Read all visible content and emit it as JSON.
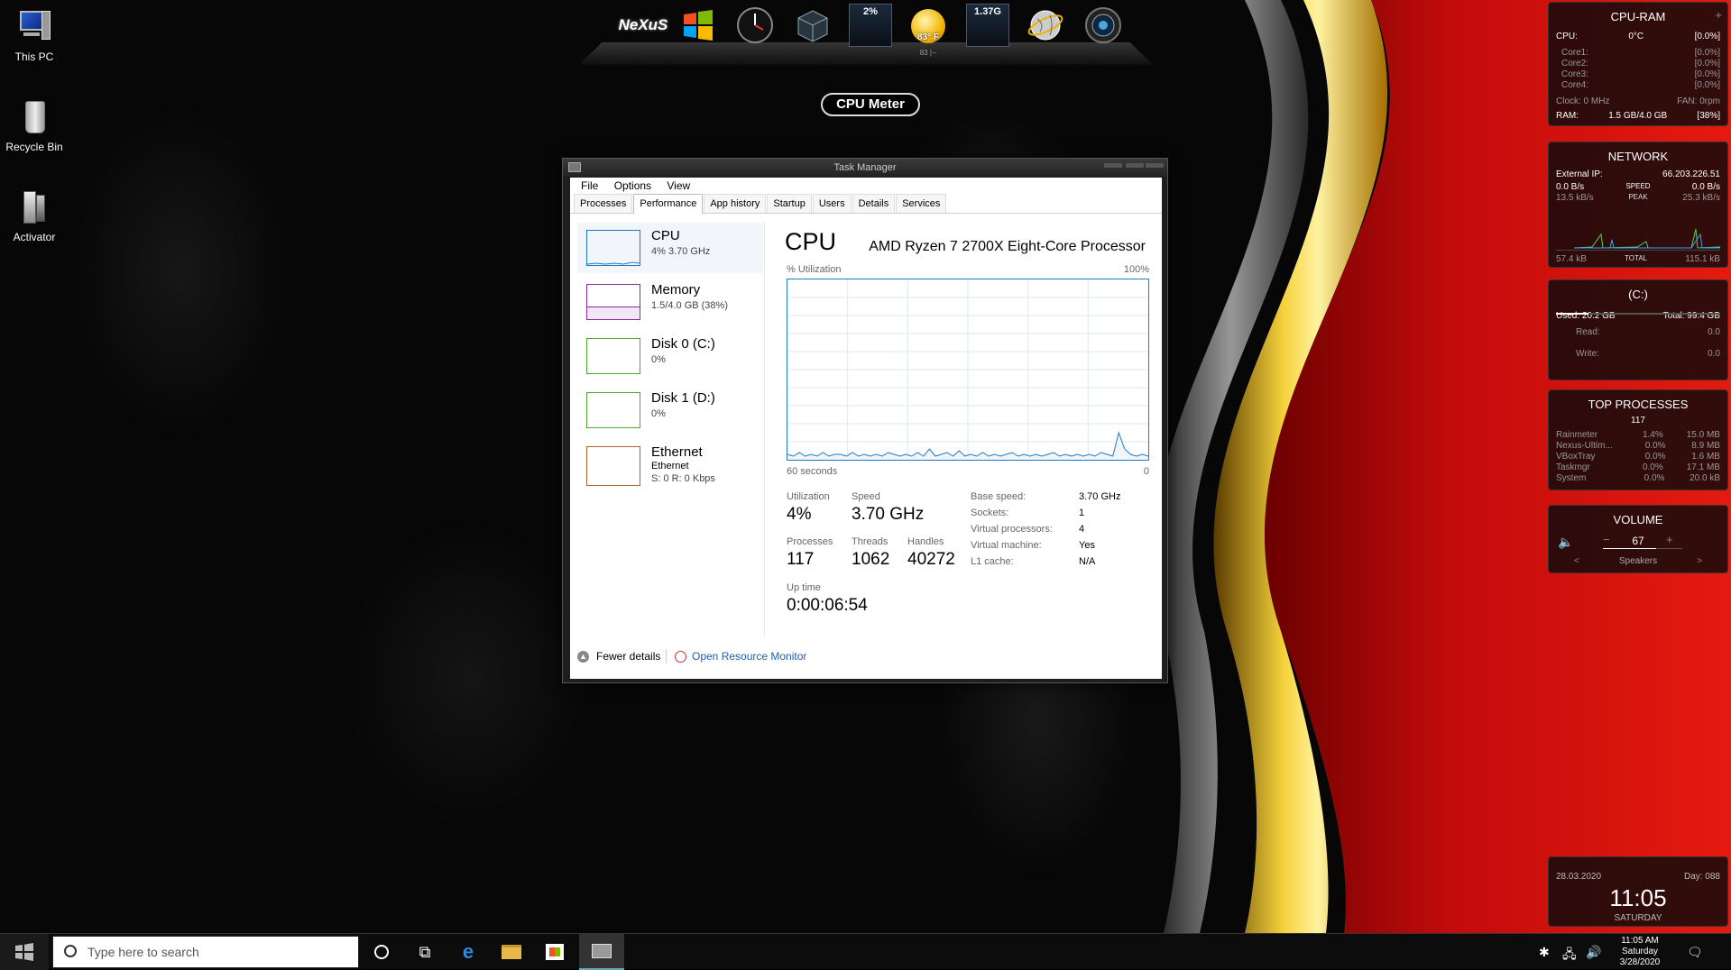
{
  "desktop": {
    "icons": [
      {
        "label": "This PC",
        "icon": "computer-icon"
      },
      {
        "label": "Recycle Bin",
        "icon": "recycle-bin-icon"
      },
      {
        "label": "Activator",
        "icon": "activator-icon"
      }
    ]
  },
  "dock": {
    "logo": "NeXuS",
    "cpu_readout": "2%",
    "weather_temp": "83° F",
    "weather_sub": "83 |--",
    "memory_readout": "1.37G",
    "meter_label": "CPU Meter"
  },
  "task_manager": {
    "title": "Task Manager",
    "menu": [
      "File",
      "Options",
      "View"
    ],
    "tabs": [
      "Processes",
      "Performance",
      "App history",
      "Startup",
      "Users",
      "Details",
      "Services"
    ],
    "active_tab": "Performance",
    "sidebar": [
      {
        "title": "CPU",
        "sub": "4% 3.70 GHz",
        "color": "#1b7ac5"
      },
      {
        "title": "Memory",
        "sub": "1.5/4.0 GB (38%)",
        "color": "#8b2ca8"
      },
      {
        "title": "Disk 0 (C:)",
        "sub": "0%",
        "color": "#4ca82c"
      },
      {
        "title": "Disk 1 (D:)",
        "sub": "0%",
        "color": "#4ca82c"
      },
      {
        "title": "Ethernet",
        "sub": "Ethernet",
        "sub2": "S: 0 R: 0 Kbps",
        "color": "#a8642c"
      }
    ],
    "main": {
      "title": "CPU",
      "model": "AMD Ryzen 7 2700X Eight-Core Processor",
      "util_label": "% Utilization",
      "max_label": "100%",
      "time_label": "60 seconds",
      "min_label": "0",
      "utilization": {
        "label": "Utilization",
        "value": "4%"
      },
      "speed": {
        "label": "Speed",
        "value": "3.70 GHz"
      },
      "processes": {
        "label": "Processes",
        "value": "117"
      },
      "threads": {
        "label": "Threads",
        "value": "1062"
      },
      "handles": {
        "label": "Handles",
        "value": "40272"
      },
      "uptime": {
        "label": "Up time",
        "value": "0:00:06:54"
      },
      "details": [
        {
          "k": "Base speed:",
          "v": "3.70 GHz"
        },
        {
          "k": "Sockets:",
          "v": "1"
        },
        {
          "k": "Virtual processors:",
          "v": "4"
        },
        {
          "k": "Virtual machine:",
          "v": "Yes"
        },
        {
          "k": "L1 cache:",
          "v": "N/A"
        }
      ],
      "graph_color": "#1b7ac5",
      "graph_values": [
        3,
        2,
        4,
        2,
        3,
        2,
        4,
        2,
        3,
        3,
        2,
        4,
        2,
        3,
        2,
        3,
        2,
        4,
        3,
        2,
        3,
        2,
        4,
        2,
        6,
        2,
        3,
        4,
        2,
        5,
        2,
        3,
        2,
        4,
        2,
        3,
        2,
        3,
        4,
        2,
        3,
        2,
        3,
        2,
        3,
        4,
        2,
        3,
        2,
        3,
        2,
        3,
        2,
        4,
        3,
        2,
        15,
        6,
        3,
        2,
        3,
        2
      ]
    },
    "footer": {
      "fewer": "Fewer details",
      "resource": "Open Resource Monitor"
    }
  },
  "gadgets": {
    "cpu_ram": {
      "title": "CPU-RAM",
      "cpu_label": "CPU:",
      "cpu_temp": "0°C",
      "cpu_pct": "[0.0%]",
      "cores": [
        {
          "label": "Core1:",
          "value": "[0.0%]"
        },
        {
          "label": "Core2:",
          "value": "[0.0%]"
        },
        {
          "label": "Core3:",
          "value": "[0.0%]"
        },
        {
          "label": "Core4:",
          "value": "[0.0%]"
        }
      ],
      "clock": "Clock: 0 MHz",
      "fan": "FAN: 0rpm",
      "ram_label": "RAM:",
      "ram_value": "1.5 GB/4.0 GB",
      "ram_pct": "[38%]"
    },
    "network": {
      "title": "NETWORK",
      "ip_label": "External IP:",
      "ip": "66.203.226.51",
      "down": "0.0 B/s",
      "speed_label": "SPEED",
      "up": "0.0 B/s",
      "down_peak": "13.5 kB/s",
      "peak_label": "PEAK",
      "up_peak": "25.3 kB/s",
      "total_down": "57.4 kB",
      "total_label": "TOTAL",
      "total_up": "115.1 kB"
    },
    "disk": {
      "title": "(C:)",
      "used": "Used: 20.2 GB",
      "total": "Total: 99.4 GB",
      "read_label": "Read:",
      "read_value": "0.0",
      "write_label": "Write:",
      "write_value": "0.0"
    },
    "top_processes": {
      "title": "TOP PROCESSES",
      "count": "117",
      "rows": [
        {
          "name": "Rainmeter",
          "cpu": "1.4%",
          "mem": "15.0 MB"
        },
        {
          "name": "Nexus-Ultim...",
          "cpu": "0.0%",
          "mem": "8.9 MB"
        },
        {
          "name": "VBoxTray",
          "cpu": "0.0%",
          "mem": "1.6 MB"
        },
        {
          "name": "Taskmgr",
          "cpu": "0.0%",
          "mem": "17.1 MB"
        },
        {
          "name": "System",
          "cpu": "0.0%",
          "mem": "20.0 kB"
        }
      ]
    },
    "volume": {
      "title": "VOLUME",
      "minus": "−",
      "level": "67",
      "plus": "+",
      "device": "Speakers",
      "prev": "<",
      "next": ">"
    },
    "clock": {
      "date": "28.03.2020",
      "day_num": "Day: 088",
      "time": "11:05",
      "weekday": "SATURDAY"
    }
  },
  "taskbar": {
    "search_placeholder": "Type here to search",
    "tray_time": "11:05 AM",
    "tray_day": "Saturday",
    "tray_date": "3/28/2020"
  }
}
